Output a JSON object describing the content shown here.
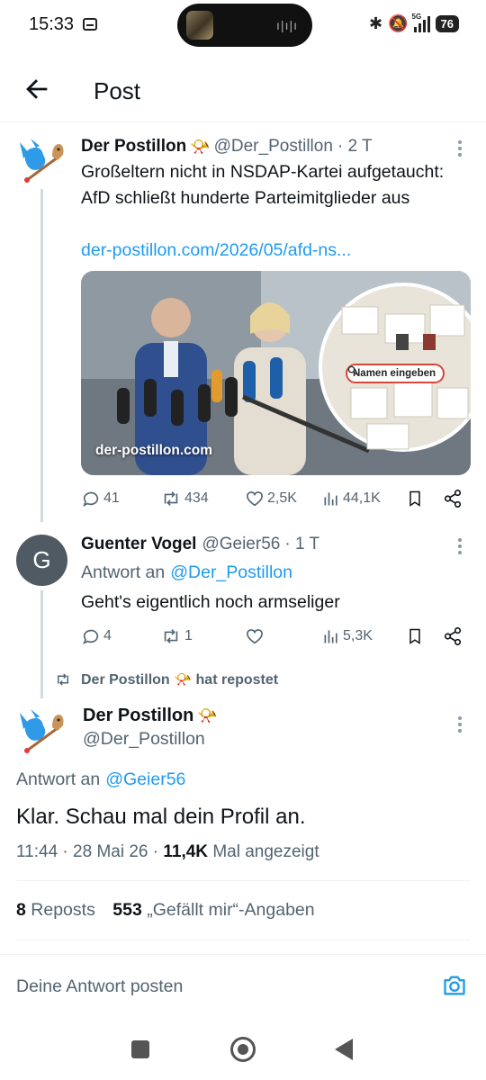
{
  "status_bar": {
    "time": "15:33",
    "network": "5G",
    "battery": "76",
    "bluetooth_icon": "bluetooth-icon",
    "mute_icon": "mute-icon"
  },
  "header": {
    "title": "Post"
  },
  "tweet1": {
    "name": "Der Postillon",
    "badge": "📯",
    "handle": "@Der_Postillon",
    "time": "· 2 T",
    "text": "Großeltern nicht in NSDAP-Kartei aufgetaucht: AfD schließt hunderte Parteimitglieder aus",
    "link": "der-postillon.com/2026/05/afd-ns...",
    "media": {
      "label": "der-postillon.com",
      "search_label": "Namen eingeben"
    },
    "actions": {
      "replies": "41",
      "reposts": "434",
      "likes": "2,5K",
      "views": "44,1K"
    }
  },
  "tweet2": {
    "avatar_letter": "G",
    "name": "Guenter Vogel",
    "handle": "@Geier56",
    "time": "· 1 T",
    "reply_prefix": "Antwort an",
    "reply_to": "@Der_Postillon",
    "text": "Geht's eigentlich noch armseliger",
    "actions": {
      "replies": "4",
      "reposts": "1",
      "likes": "",
      "views": "5,3K"
    }
  },
  "repost_banner": {
    "name": "Der Postillon",
    "badge": "📯",
    "suffix": "hat repostet"
  },
  "main_tweet": {
    "name": "Der Postillon",
    "badge": "📯",
    "handle": "@Der_Postillon",
    "reply_prefix": "Antwort an",
    "reply_to": "@Geier56",
    "text": "Klar. Schau mal dein Profil an.",
    "time": "11:44",
    "date": "28 Mai 26",
    "views": "11,4K",
    "views_label": "Mal angezeigt",
    "reposts_count": "8",
    "reposts_label": "Reposts",
    "likes_count": "553",
    "likes_label": "„Gefällt mir“-Angaben"
  },
  "reply_bar": {
    "placeholder": "Deine Antwort posten"
  },
  "colors": {
    "link": "#1d9bf0",
    "muted": "#536471",
    "text": "#0f1419"
  }
}
